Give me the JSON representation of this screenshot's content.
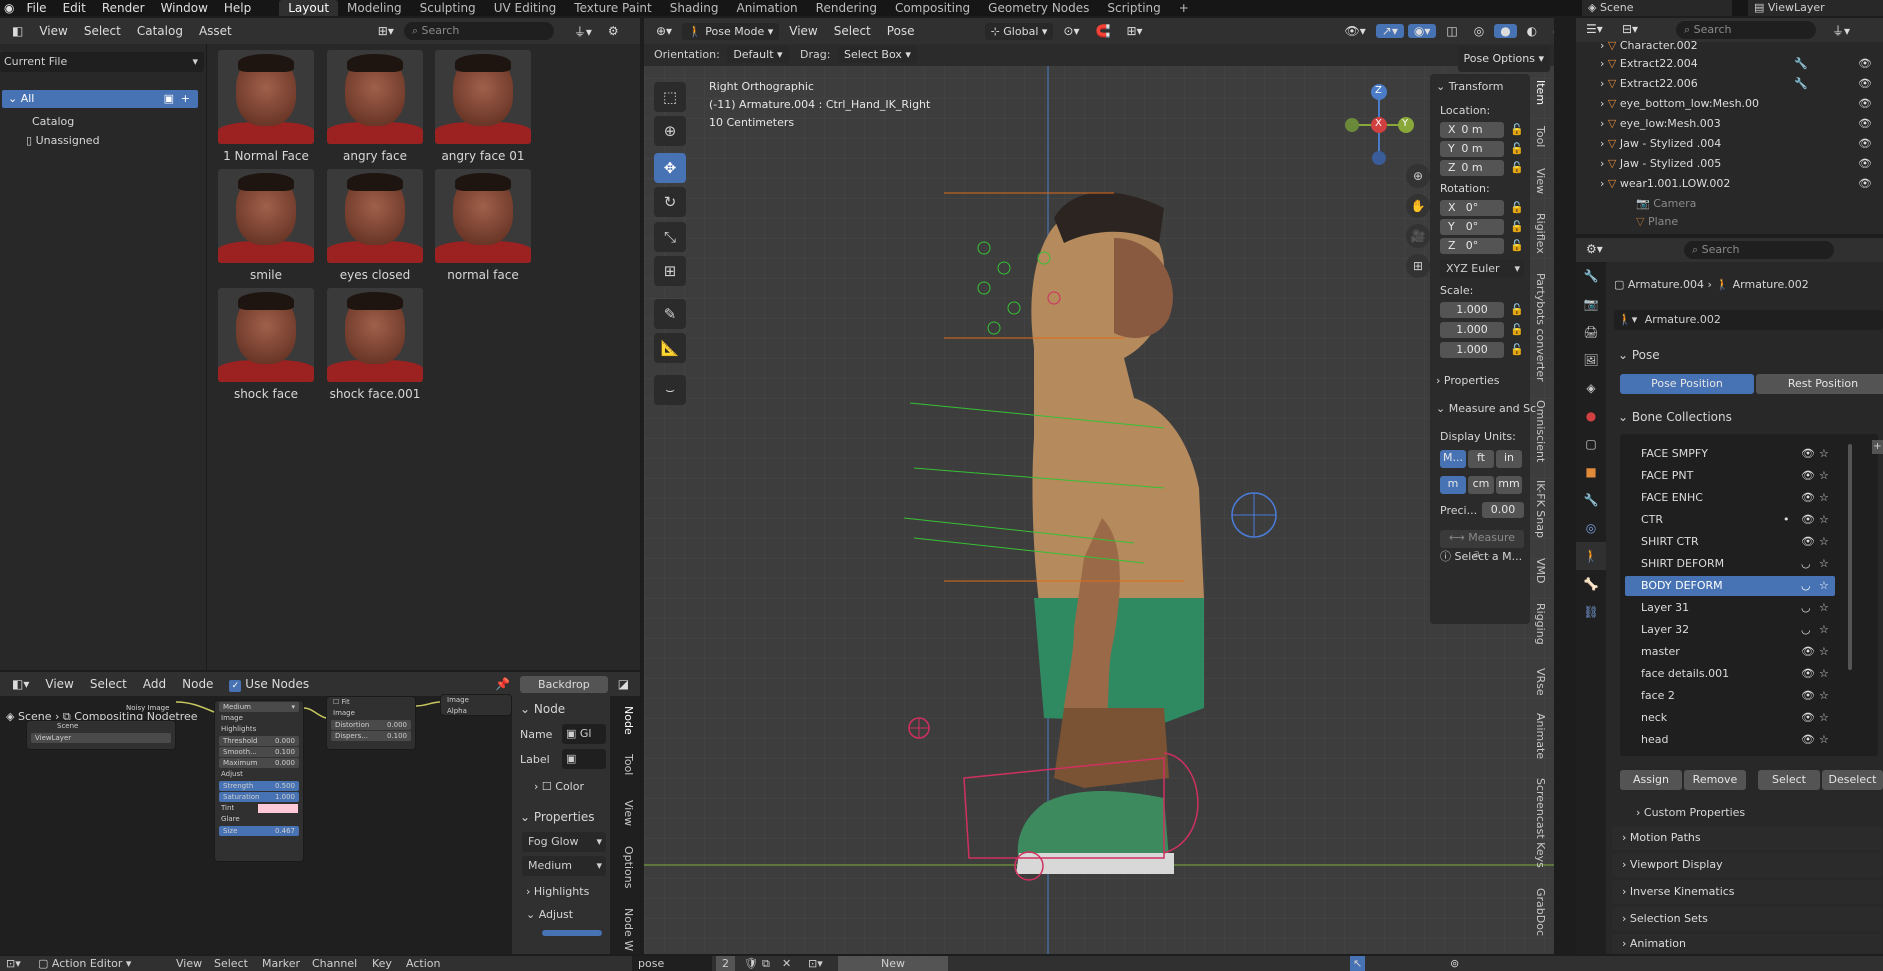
{
  "topbar": {
    "menus": [
      "File",
      "Edit",
      "Render",
      "Window",
      "Help"
    ],
    "workspaces": [
      "Layout",
      "Modeling",
      "Sculpting",
      "UV Editing",
      "Texture Paint",
      "Shading",
      "Animation",
      "Rendering",
      "Compositing",
      "Geometry Nodes",
      "Scripting"
    ],
    "active_workspace": "Layout",
    "scene": "Scene",
    "view_layer": "ViewLayer"
  },
  "asset_browser": {
    "menus": [
      "View",
      "Select",
      "Catalog",
      "Asset"
    ],
    "search_placeholder": "Search",
    "library": "Current File",
    "catalogs": {
      "all": "All",
      "catalog": "Catalog",
      "unassigned": "Unassigned"
    },
    "assets": [
      {
        "label": "1 Normal Face"
      },
      {
        "label": "angry face"
      },
      {
        "label": "angry face 01"
      },
      {
        "label": "smile"
      },
      {
        "label": "eyes closed"
      },
      {
        "label": "normal face"
      },
      {
        "label": "shock face"
      },
      {
        "label": "shock face.001"
      }
    ]
  },
  "node_editor": {
    "menus": [
      "View",
      "Select",
      "Add",
      "Node"
    ],
    "use_nodes": "Use Nodes",
    "backdrop": "Backdrop",
    "breadcrumb": {
      "scene": "Scene",
      "tree": "Compositing Nodetree"
    },
    "render_layers": {
      "scene": "Scene",
      "view_layer": "ViewLayer"
    },
    "noisy_image": "Noisy Image",
    "glare": {
      "quality": "Medium",
      "image": "Image",
      "highlights": "Highlights",
      "threshold": {
        "label": "Threshold",
        "value": "0.000"
      },
      "smoothness": {
        "label": "Smooth...",
        "value": "0.100"
      },
      "maximum": {
        "label": "Maximum",
        "value": "0.000"
      },
      "adjust": "Adjust",
      "strength": {
        "label": "Strength",
        "value": "0.500"
      },
      "saturation": {
        "label": "Saturation",
        "value": "1.000"
      },
      "tint": "Tint",
      "glare_section": "Glare",
      "size": {
        "label": "Size",
        "value": "0.467"
      }
    },
    "lens": {
      "fit": "Fit",
      "image": "Image",
      "distortion": {
        "label": "Distortion",
        "value": "0.000"
      },
      "dispersion": {
        "label": "Dispers...",
        "value": "0.100"
      }
    },
    "composite": {
      "image": "Image",
      "alpha": "Alpha"
    },
    "sidebar": {
      "node_title": "Node",
      "name_label": "Name",
      "name_value": "Gl",
      "label_label": "Label",
      "color": "Color",
      "properties": "Properties",
      "type": "Fog Glow",
      "quality": "Medium",
      "highlights": "Highlights",
      "adjust": "Adjust",
      "tabs": [
        "Node",
        "Tool",
        "View",
        "Options",
        "Node W"
      ]
    }
  },
  "viewport": {
    "mode": "Pose Mode",
    "menus": [
      "View",
      "Select",
      "Pose"
    ],
    "transform_space": "Global",
    "orientation_label": "Orientation:",
    "orientation": "Default",
    "drag_label": "Drag:",
    "drag": "Select Box",
    "pose_options": "Pose Options",
    "overlay": {
      "view_name": "Right Orthographic",
      "object": "(-11) Armature.004 : Ctrl_Hand_IK_Right",
      "scale": "10 Centimeters"
    },
    "gizmo": {
      "x": "X",
      "y": "Y",
      "z": "Z"
    },
    "n_panel": {
      "transform": "Transform",
      "location": "Location:",
      "loc": [
        {
          "axis": "X",
          "value": "0 m"
        },
        {
          "axis": "Y",
          "value": "0 m"
        },
        {
          "axis": "Z",
          "value": "0 m"
        }
      ],
      "rotation": "Rotation:",
      "rot": [
        {
          "axis": "X",
          "value": "0°"
        },
        {
          "axis": "Y",
          "value": "0°"
        },
        {
          "axis": "Z",
          "value": "0°"
        }
      ],
      "rotation_mode": "XYZ Euler",
      "scale_label": "Scale:",
      "scale": [
        "1.000",
        "1.000",
        "1.000"
      ],
      "properties": "Properties",
      "measure": "Measure and Sc",
      "display_units": "Display Units:",
      "units1": [
        "M...",
        "ft",
        "in"
      ],
      "units2": [
        "m",
        "cm",
        "mm"
      ],
      "precision_label": "Preci...",
      "precision_value": "0.00",
      "measure_btn": "Measure a...",
      "select_btn": "Select a M..."
    },
    "side_tabs": [
      "Item",
      "Tool",
      "View",
      "Rigiflex",
      "Partybots converter",
      "Omniscient",
      "IK-FK Snap",
      "VMD",
      "Rigging",
      "VRse",
      "Animate",
      "Screencast Keys",
      "GrabDoc"
    ]
  },
  "outliner": {
    "search_placeholder": "Search",
    "items": [
      {
        "label": "Character.002"
      },
      {
        "label": "Extract22.004"
      },
      {
        "label": "Extract22.006"
      },
      {
        "label": "eye_bottom_low:Mesh.00"
      },
      {
        "label": "eye_low:Mesh.003"
      },
      {
        "label": "Jaw - Stylized .004"
      },
      {
        "label": "Jaw - Stylized .005"
      },
      {
        "label": "wear1.001.LOW.002"
      },
      {
        "label": "Camera"
      },
      {
        "label": "Plane"
      }
    ]
  },
  "properties": {
    "search_placeholder": "Search",
    "breadcrumb": {
      "object": "Armature.004",
      "data": "Armature.002"
    },
    "data_name": "Armature.002",
    "pose_section": "Pose",
    "pose_position": "Pose Position",
    "rest_position": "Rest Position",
    "bone_collections": "Bone Collections",
    "collections": [
      {
        "label": "FACE SMPFY"
      },
      {
        "label": "FACE PNT"
      },
      {
        "label": "FACE ENHC"
      },
      {
        "label": "CTR"
      },
      {
        "label": "SHIRT CTR"
      },
      {
        "label": "SHIRT DEFORM"
      },
      {
        "label": "BODY DEFORM"
      },
      {
        "label": "Layer 31"
      },
      {
        "label": "Layer 32"
      },
      {
        "label": "master"
      },
      {
        "label": "face details.001"
      },
      {
        "label": "face 2"
      },
      {
        "label": "neck"
      },
      {
        "label": "head"
      }
    ],
    "selected_collection": "BODY DEFORM",
    "buttons": [
      "Assign",
      "Remove",
      "Select",
      "Deselect"
    ],
    "sections": [
      "Custom Properties",
      "Motion Paths",
      "Viewport Display",
      "Inverse Kinematics",
      "Selection Sets",
      "Animation"
    ]
  },
  "timeline": {
    "editor": "Action Editor",
    "menus": [
      "View",
      "Select",
      "Marker",
      "Channel",
      "Key",
      "Action"
    ],
    "action": "pose",
    "users": "2",
    "new_btn": "New"
  },
  "colors": {
    "accent": "#4772b3",
    "background": "#1d1d1d",
    "header": "#303030"
  }
}
